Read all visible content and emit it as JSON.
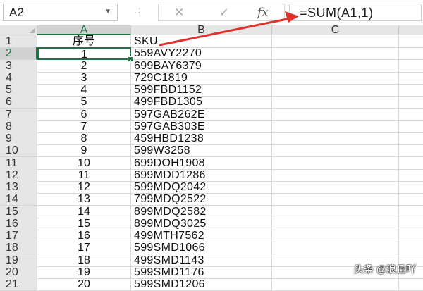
{
  "formula_bar": {
    "name_box": "A2",
    "cancel_icon": "✕",
    "enter_icon": "✓",
    "fx_label": "fx",
    "formula": "=SUM(A1,1)"
  },
  "columns": [
    "A",
    "B",
    "C"
  ],
  "active_cell": "A2",
  "rows": [
    {
      "num": "1",
      "a": "序号",
      "b": "SKU"
    },
    {
      "num": "2",
      "a": "1",
      "b": "559AVY2270"
    },
    {
      "num": "3",
      "a": "2",
      "b": "699BAY6379"
    },
    {
      "num": "4",
      "a": "3",
      "b": "729C1819"
    },
    {
      "num": "5",
      "a": "4",
      "b": "599FBD1152"
    },
    {
      "num": "6",
      "a": "5",
      "b": "499FBD1305"
    },
    {
      "num": "7",
      "a": "6",
      "b": "597GAB262E"
    },
    {
      "num": "8",
      "a": "7",
      "b": "597GAB303E"
    },
    {
      "num": "9",
      "a": "8",
      "b": "459HBD1238"
    },
    {
      "num": "10",
      "a": "9",
      "b": "599W3258"
    },
    {
      "num": "11",
      "a": "10",
      "b": "699DOH1908"
    },
    {
      "num": "12",
      "a": "11",
      "b": "699MDD1286"
    },
    {
      "num": "13",
      "a": "12",
      "b": "599MDQ2042"
    },
    {
      "num": "14",
      "a": "13",
      "b": "799MDQ2522"
    },
    {
      "num": "15",
      "a": "14",
      "b": "899MDQ2582"
    },
    {
      "num": "16",
      "a": "15",
      "b": "899MDQ3025"
    },
    {
      "num": "17",
      "a": "16",
      "b": "499MTH7562"
    },
    {
      "num": "18",
      "a": "17",
      "b": "599SMD1066"
    },
    {
      "num": "19",
      "a": "18",
      "b": "499SMD1143"
    },
    {
      "num": "20",
      "a": "19",
      "b": "599SMD1176"
    },
    {
      "num": "21",
      "a": "20",
      "b": "599SMD1206"
    }
  ],
  "watermark": "头条 @浪丘吖",
  "colors": {
    "excel_green": "#217346",
    "annotation_red": "#e0312b",
    "header_gray": "#e6e6e6"
  }
}
